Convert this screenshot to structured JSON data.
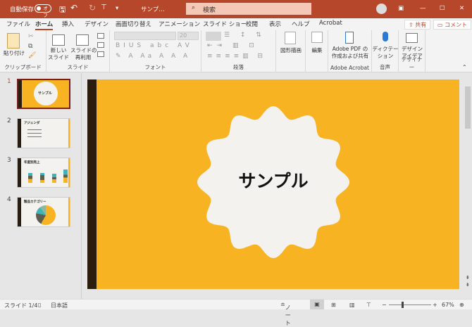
{
  "titlebar": {
    "autosave": "自動保存",
    "autosave_state": "オフ",
    "filename": "サンプ…",
    "search_placeholder": "検索"
  },
  "tabs": [
    "ファイル",
    "ホーム",
    "挿入",
    "デザイン",
    "画面切り替え",
    "アニメーション",
    "スライド ショー",
    "校閲",
    "表示",
    "ヘルプ",
    "Acrobat"
  ],
  "share": "共有",
  "comment": "コメント",
  "ribbon": {
    "clipboard": {
      "label": "クリップボード",
      "paste": "貼り付け"
    },
    "slides": {
      "label": "スライド",
      "new_slide": "新しい\nスライド",
      "reuse": "スライドの\n再利用"
    },
    "font": {
      "label": "フォント",
      "size": "20"
    },
    "paragraph": {
      "label": "段落"
    },
    "drawing": {
      "label": "図形描画"
    },
    "editing": {
      "label": "編集"
    },
    "acrobat": {
      "btn1": "Adobe PDF の",
      "btn2": "作成および共有",
      "label": "Adobe Acrobat"
    },
    "voice": {
      "btn1": "ディクテー",
      "btn2": "ション",
      "label": "音声"
    },
    "designer": {
      "btn1": "デザイン",
      "btn2": "アイデア",
      "label": "デザイナー"
    }
  },
  "thumbnails": [
    {
      "num": "1",
      "title": "サンプル"
    },
    {
      "num": "2",
      "title": "アジェンダ"
    },
    {
      "num": "3",
      "title": "年度別売上"
    },
    {
      "num": "4",
      "title": "製品カテゴリー"
    }
  ],
  "slide": {
    "title": "サンプル",
    "bg": "#f8b323",
    "accent": "#2b1d0e"
  },
  "status": {
    "slide": "スライド 1/4",
    "lang": "日本語",
    "notes": "ノート",
    "zoom": "67%",
    "zoom_percent": 67
  }
}
